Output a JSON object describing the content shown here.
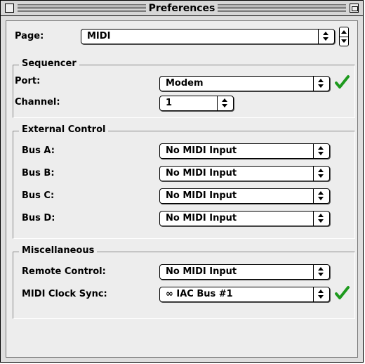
{
  "window": {
    "title": "Preferences"
  },
  "page": {
    "label": "Page:",
    "value": "MIDI"
  },
  "sequencer": {
    "title": "Sequencer",
    "port_label": "Port:",
    "port_value": "Modem",
    "channel_label": "Channel:",
    "channel_value": "1"
  },
  "external_control": {
    "title": "External Control",
    "buses": [
      {
        "label": "Bus A:",
        "value": "No MIDI Input"
      },
      {
        "label": "Bus B:",
        "value": "No MIDI Input"
      },
      {
        "label": "Bus C:",
        "value": "No MIDI Input"
      },
      {
        "label": "Bus D:",
        "value": "No MIDI Input"
      }
    ]
  },
  "miscellaneous": {
    "title": "Miscellaneous",
    "remote_label": "Remote Control:",
    "remote_value": "No MIDI Input",
    "clock_label": "MIDI Clock Sync:",
    "clock_value": "∞ IAC Bus #1"
  },
  "colors": {
    "check": "#1e9a1e",
    "panel": "#ededed",
    "titlebar": "#d6d6d6"
  },
  "icons": [
    "close-box-icon",
    "zoom-box-icon",
    "popup-arrows-icon",
    "stepper-arrows-icon",
    "checkmark-icon"
  ]
}
